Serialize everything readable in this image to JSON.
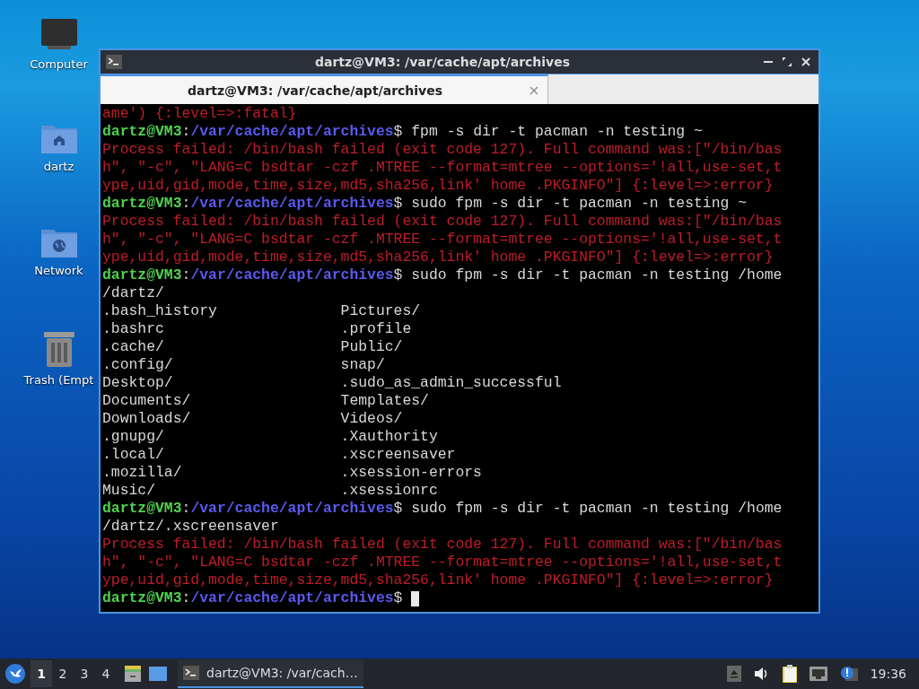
{
  "desktop_icons": [
    {
      "label": "Computer",
      "kind": "computer"
    },
    {
      "label": "dartz",
      "kind": "home"
    },
    {
      "label": "Network",
      "kind": "network"
    },
    {
      "label": "Trash (Empt",
      "kind": "trash"
    }
  ],
  "window": {
    "title": "dartz@VM3: /var/cache/apt/archives"
  },
  "tabs": [
    {
      "label": "dartz@VM3: /var/cache/apt/archives",
      "selected": true
    }
  ],
  "terminal_lines": [
    {
      "kind": "error",
      "text": "ame') {:level=>:fatal}"
    },
    {
      "kind": "prompt",
      "user": "dartz@VM3",
      "separator": ":",
      "path": "/var/cache/apt/archives",
      "symbol": "$",
      "command": "fpm -s dir -t pacman -n testing ~"
    },
    {
      "kind": "error",
      "text": "Process failed: /bin/bash failed (exit code 127). Full command was:[\"/bin/bas"
    },
    {
      "kind": "error",
      "text": "h\", \"-c\", \"LANG=C bsdtar -czf .MTREE --format=mtree --options='!all,use-set,t"
    },
    {
      "kind": "error",
      "text": "ype,uid,gid,mode,time,size,md5,sha256,link' home .PKGINFO\"] {:level=>:error}"
    },
    {
      "kind": "prompt",
      "user": "dartz@VM3",
      "separator": ":",
      "path": "/var/cache/apt/archives",
      "symbol": "$",
      "command": "sudo fpm -s dir -t pacman -n testing ~"
    },
    {
      "kind": "error",
      "text": "Process failed: /bin/bash failed (exit code 127). Full command was:[\"/bin/bas"
    },
    {
      "kind": "error",
      "text": "h\", \"-c\", \"LANG=C bsdtar -czf .MTREE --format=mtree --options='!all,use-set,t"
    },
    {
      "kind": "error",
      "text": "ype,uid,gid,mode,time,size,md5,sha256,link' home .PKGINFO\"] {:level=>:error}"
    },
    {
      "kind": "prompt",
      "user": "dartz@VM3",
      "separator": ":",
      "path": "/var/cache/apt/archives",
      "symbol": "$",
      "command": "sudo fpm -s dir -t pacman -n testing /home"
    },
    {
      "kind": "output",
      "text": "/dartz/"
    },
    {
      "kind": "listing",
      "cells": [
        ".bash_history",
        "Pictures/"
      ]
    },
    {
      "kind": "listing",
      "cells": [
        ".bashrc",
        ".profile"
      ]
    },
    {
      "kind": "listing",
      "cells": [
        ".cache/",
        "Public/"
      ]
    },
    {
      "kind": "listing",
      "cells": [
        ".config/",
        "snap/"
      ]
    },
    {
      "kind": "listing",
      "cells": [
        "Desktop/",
        ".sudo_as_admin_successful"
      ]
    },
    {
      "kind": "listing",
      "cells": [
        "Documents/",
        "Templates/"
      ]
    },
    {
      "kind": "listing",
      "cells": [
        "Downloads/",
        "Videos/"
      ]
    },
    {
      "kind": "listing",
      "cells": [
        ".gnupg/",
        ".Xauthority"
      ]
    },
    {
      "kind": "listing",
      "cells": [
        ".local/",
        ".xscreensaver"
      ]
    },
    {
      "kind": "listing",
      "cells": [
        ".mozilla/",
        ".xsession-errors"
      ]
    },
    {
      "kind": "listing",
      "cells": [
        "Music/",
        ".xsessionrc"
      ]
    },
    {
      "kind": "prompt",
      "user": "dartz@VM3",
      "separator": ":",
      "path": "/var/cache/apt/archives",
      "symbol": "$",
      "command": "sudo fpm -s dir -t pacman -n testing /home"
    },
    {
      "kind": "output",
      "text": "/dartz/.xscreensaver"
    },
    {
      "kind": "error",
      "text": "Process failed: /bin/bash failed (exit code 127). Full command was:[\"/bin/bas"
    },
    {
      "kind": "error",
      "text": "h\", \"-c\", \"LANG=C bsdtar -czf .MTREE --format=mtree --options='!all,use-set,t"
    },
    {
      "kind": "error",
      "text": "ype,uid,gid,mode,time,size,md5,sha256,link' home .PKGINFO\"] {:level=>:error}"
    },
    {
      "kind": "prompt",
      "user": "dartz@VM3",
      "separator": ":",
      "path": "/var/cache/apt/archives",
      "symbol": "$",
      "cursor": true
    }
  ],
  "taskbar": {
    "workspaces": [
      {
        "label": "1",
        "selected": true
      },
      {
        "label": "2",
        "selected": false
      },
      {
        "label": "3",
        "selected": false
      },
      {
        "label": "4",
        "selected": false
      }
    ],
    "tasks": [
      {
        "label": "dartz@VM3: /var/cach…",
        "selected": true
      }
    ],
    "clock": "19:36"
  }
}
